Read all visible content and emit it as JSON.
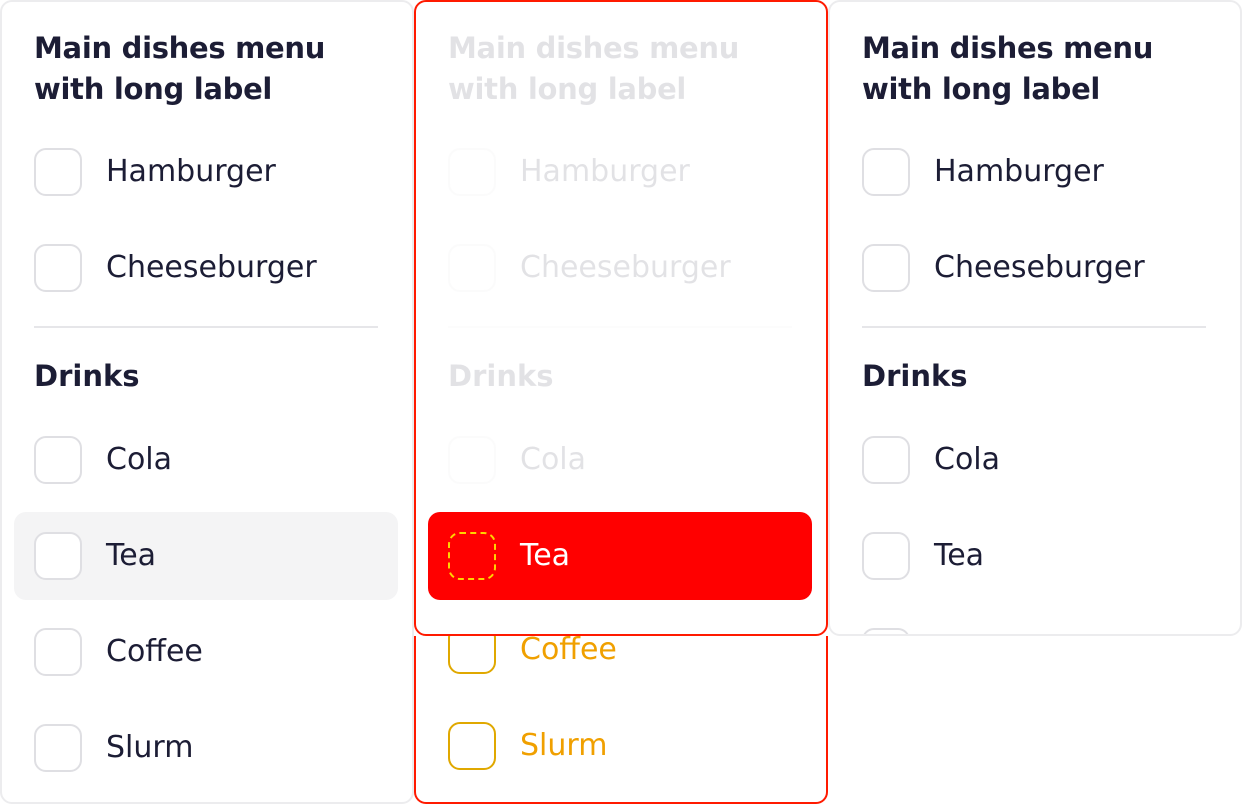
{
  "groups": {
    "main": {
      "title": "Main dishes menu with long label",
      "items": [
        "Hamburger",
        "Cheeseburger"
      ]
    },
    "drinks": {
      "title": "Drinks",
      "items": [
        "Cola",
        "Tea",
        "Coffee",
        "Slurm"
      ]
    }
  },
  "colors": {
    "text": "#1c1d35",
    "border": "#dfdfe3",
    "hover_bg": "#f4f4f5",
    "active_bg": "#ff0000",
    "focus_ring": "#ffd400",
    "overflow_text": "#f0a000"
  }
}
